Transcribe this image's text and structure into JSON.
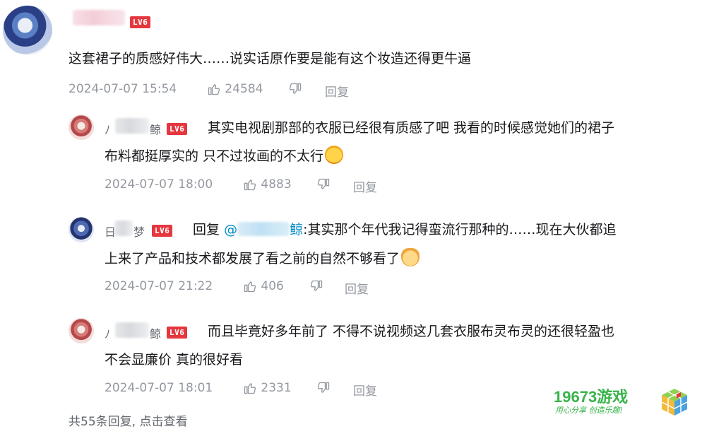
{
  "main_comment": {
    "user_level": "LV6",
    "text": "这套裙子的质感好伟大……说实话原作要是能有这个妆造还得更牛逼",
    "timestamp": "2024-07-07 15:54",
    "likes": "24584",
    "reply_label": "回复"
  },
  "replies": [
    {
      "username_visible_start": "ﾉ",
      "username_visible_end": "鲸",
      "user_level": "LV6",
      "text_line1": "其实电视剧那部的衣服已经很有质感了吧 我看的时候感觉她们的裙子",
      "text_line2": "布料都挺厚实的 只不过妆画的不太行",
      "emoji": "laugh-cry-emoji",
      "timestamp": "2024-07-07 18:00",
      "likes": "4883",
      "reply_label": "回复"
    },
    {
      "username_visible_start": "日",
      "username_visible_end": "梦",
      "user_level": "LV6",
      "reply_prefix": "回复",
      "mention_at": "@",
      "mention_end": "鲸",
      "text_line1": ":其实那个年代我记得蛮流行那种的……现在大伙都追",
      "text_line2": "上来了产品和技术都发展了看之前的自然不够看了",
      "emoji": "cat-emoji",
      "timestamp": "2024-07-07 21:22",
      "likes": "406",
      "reply_label": "回复"
    },
    {
      "username_visible_start": "ﾉ",
      "username_visible_end": "鲸",
      "user_level": "LV6",
      "text_line1": "而且毕竟好多年前了 不得不说视频这几套衣服布灵布灵的还很轻盈也",
      "text_line2": "不会显廉价 真的很好看",
      "timestamp": "2024-07-07 18:01",
      "likes": "2331",
      "reply_label": "回复"
    }
  ],
  "footer": {
    "summary": "共55条回复, 点击查看"
  },
  "watermark": {
    "title": "19673游戏",
    "subtitle": "用心分享 创造乐趣!"
  },
  "colors": {
    "text": "#18191c",
    "meta": "#9499a0",
    "mention": "#008ac5",
    "level_badge": "#e4373e",
    "watermark_green": "#3ab44a"
  },
  "icons": {
    "like": "thumb-up-icon",
    "dislike": "thumb-down-icon"
  }
}
